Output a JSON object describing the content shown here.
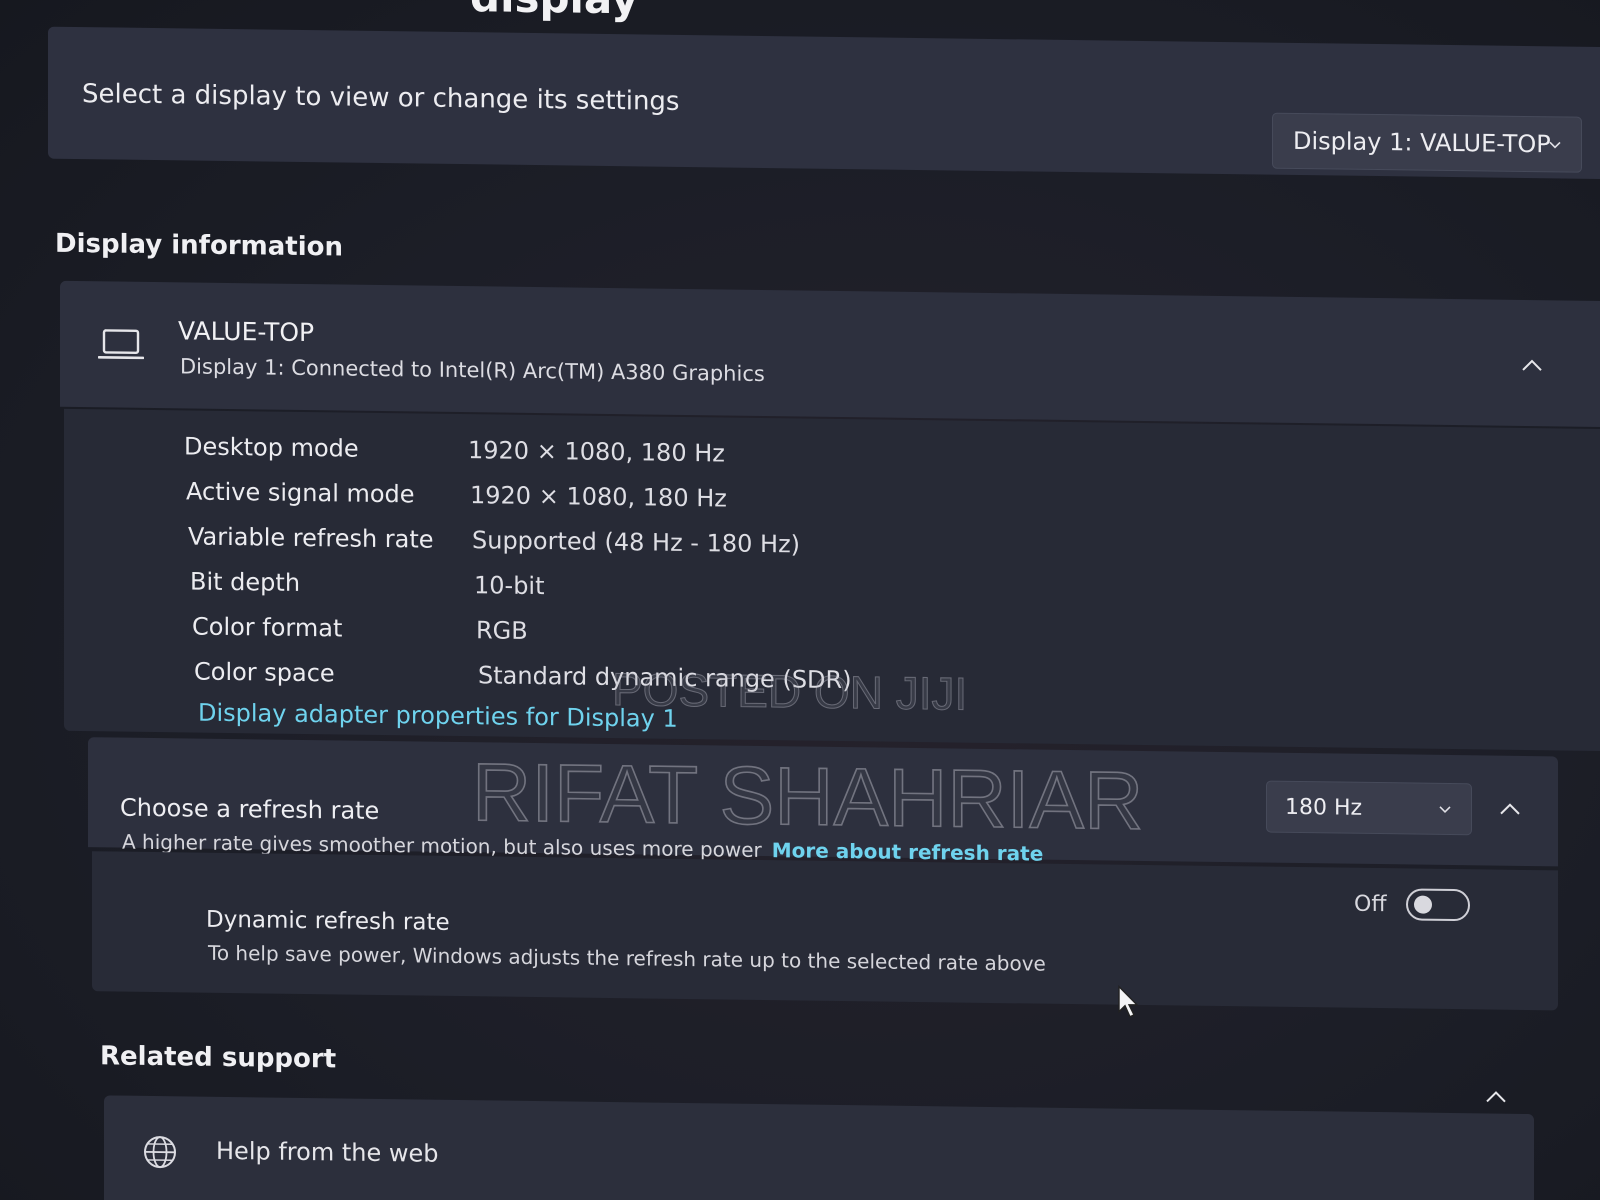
{
  "page": {
    "title_fragment": "display"
  },
  "display_select": {
    "label": "Select a display to view or change its settings",
    "selected": "Display 1: VALUE-TOP"
  },
  "display_information": {
    "heading": "Display information",
    "monitor_name": "VALUE-TOP",
    "monitor_subtitle": "Display 1: Connected to Intel(R) Arc(TM) A380 Graphics",
    "properties": [
      {
        "label": "Desktop mode",
        "value": "1920 × 1080, 180 Hz"
      },
      {
        "label": "Active signal mode",
        "value": "1920 × 1080, 180 Hz"
      },
      {
        "label": "Variable refresh rate",
        "value": "Supported (48 Hz - 180 Hz)"
      },
      {
        "label": "Bit depth",
        "value": "10-bit"
      },
      {
        "label": "Color format",
        "value": "RGB"
      },
      {
        "label": "Color space",
        "value": "Standard dynamic range (SDR)"
      }
    ],
    "adapter_link": "Display adapter properties for Display 1"
  },
  "refresh_rate": {
    "title": "Choose a refresh rate",
    "description": "A higher rate gives smoother motion, but also uses more power",
    "link": "More about refresh rate",
    "selected": "180 Hz"
  },
  "dynamic_refresh": {
    "title": "Dynamic refresh rate",
    "description": "To help save power, Windows adjusts the refresh rate up to the selected rate above",
    "state_label": "Off",
    "enabled": false
  },
  "related_support": {
    "heading": "Related support",
    "items": [
      {
        "label": "Help from the web",
        "icon": "globe-icon"
      }
    ]
  },
  "watermarks": {
    "small": "POSTED ON JIJI",
    "large": "RIFAT SHAHRIAR"
  },
  "colors": {
    "accent_link": "#6fd3ee",
    "card": "#2b2e3b",
    "background": "#1b1d26"
  }
}
